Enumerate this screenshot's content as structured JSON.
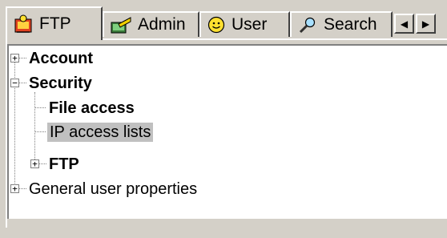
{
  "tabs": [
    {
      "label": "FTP",
      "icon": "ftp-icon",
      "active": true
    },
    {
      "label": "Admin",
      "icon": "admin-icon",
      "active": false
    },
    {
      "label": "User",
      "icon": "smiley-icon",
      "active": false
    },
    {
      "label": "Search",
      "icon": "magnifier-icon",
      "active": false
    }
  ],
  "tab_scroll": {
    "left": "◀",
    "right": "▶"
  },
  "tree": {
    "account": "Account",
    "security": "Security",
    "file_access": "File access",
    "ip_access_lists": "IP access lists",
    "ftp": "FTP",
    "general_user_properties": "General user properties",
    "expand_symbol": "+",
    "collapse_symbol": "−"
  },
  "colors": {
    "selection": "#c0c0c0",
    "window": "#d4d0c8"
  }
}
